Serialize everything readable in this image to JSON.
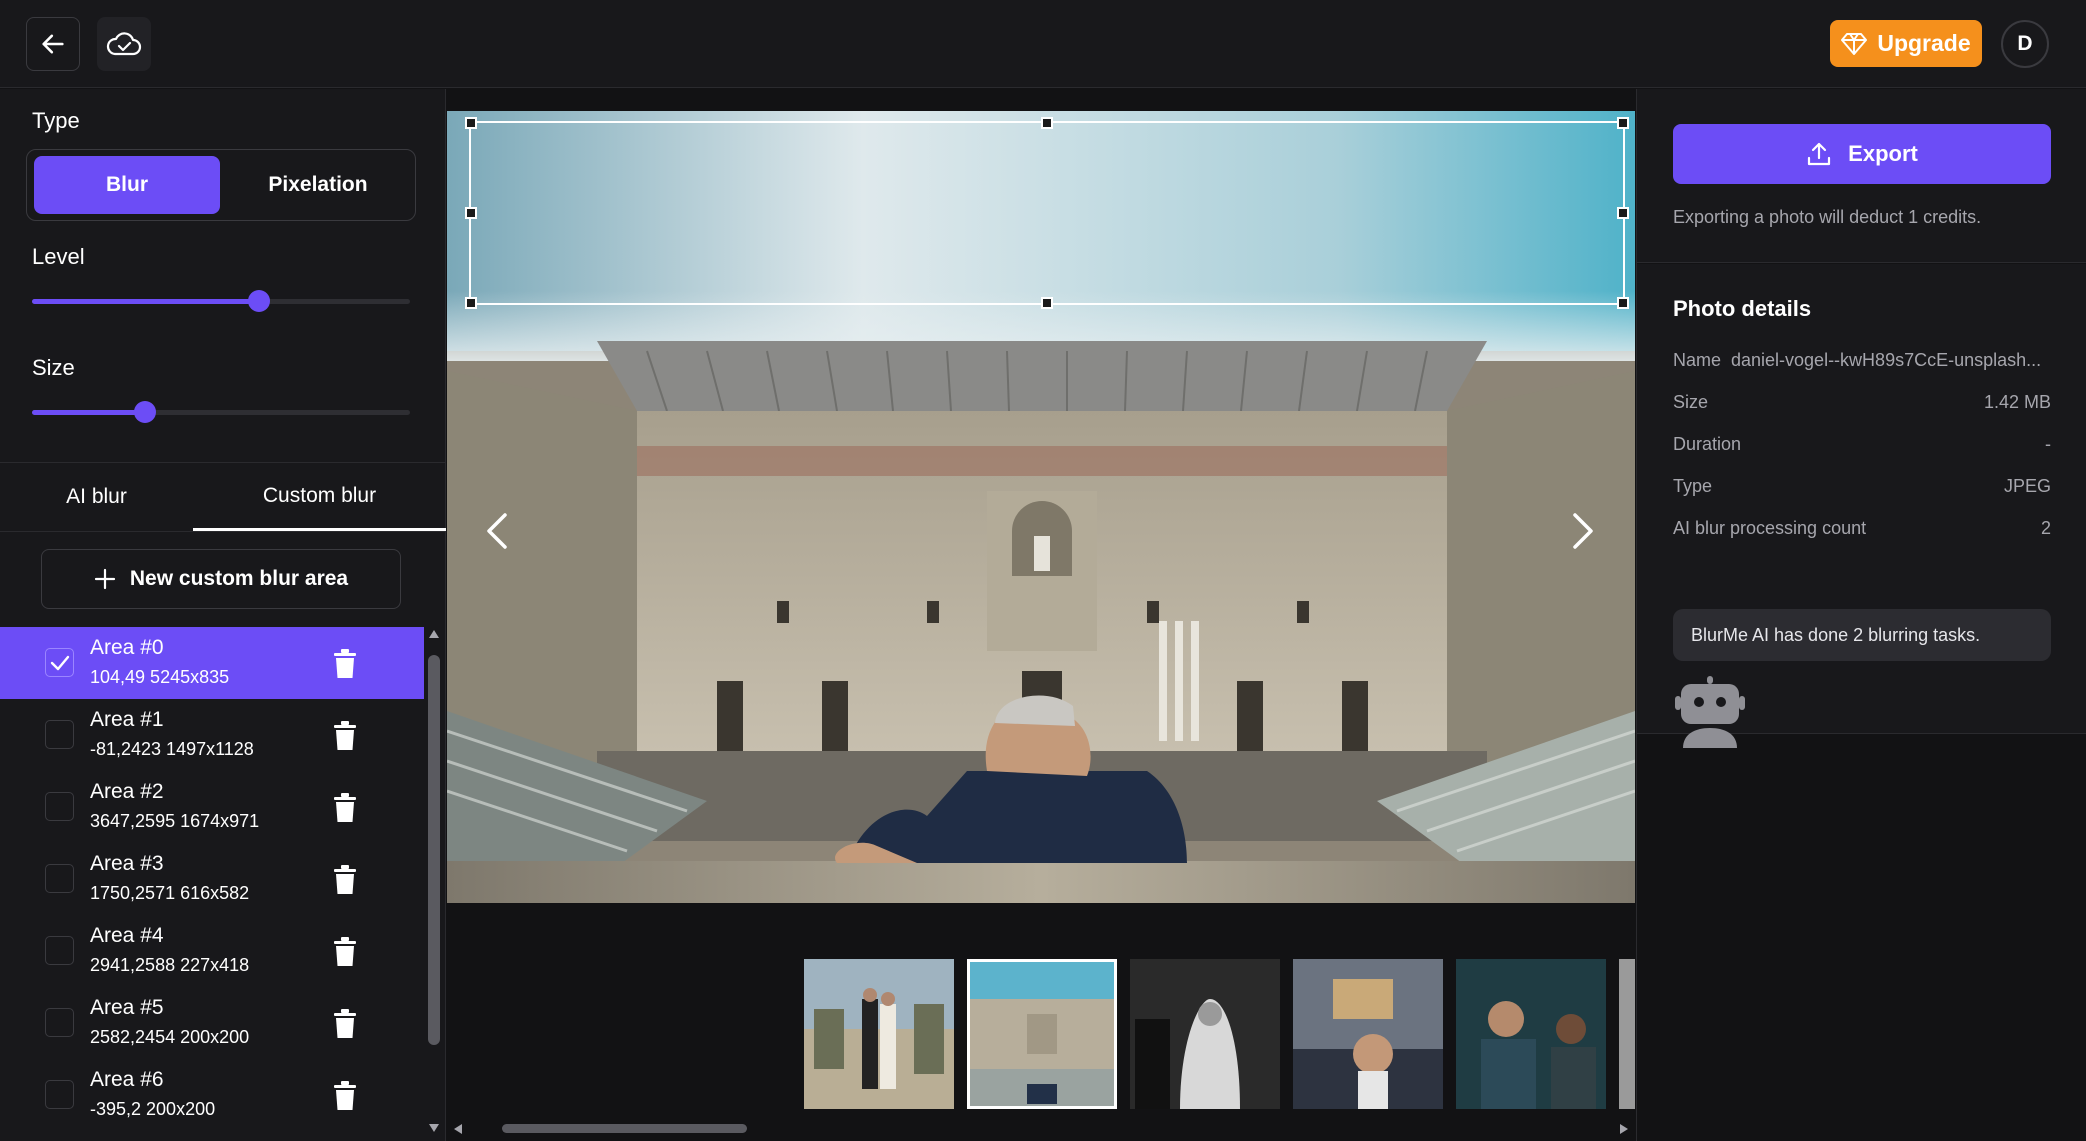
{
  "topbar": {
    "upgrade_label": "Upgrade",
    "avatar_initial": "D"
  },
  "left": {
    "type_label": "Type",
    "type_options": [
      "Blur",
      "Pixelation"
    ],
    "selected_type": "Blur",
    "level_label": "Level",
    "level_fraction": 0.6,
    "size_label": "Size",
    "size_fraction": 0.3,
    "tabs": [
      "AI blur",
      "Custom blur"
    ],
    "active_tab": "Custom blur",
    "new_area_label": "New custom blur area",
    "areas": [
      {
        "name": "Area #0",
        "coords": "104,49 5245x835",
        "checked": true
      },
      {
        "name": "Area #1",
        "coords": "-81,2423 1497x1128",
        "checked": false
      },
      {
        "name": "Area #2",
        "coords": "3647,2595 1674x971",
        "checked": false
      },
      {
        "name": "Area #3",
        "coords": "1750,2571 616x582",
        "checked": false
      },
      {
        "name": "Area #4",
        "coords": "2941,2588 227x418",
        "checked": false
      },
      {
        "name": "Area #5",
        "coords": "2582,2454 200x200",
        "checked": false
      },
      {
        "name": "Area #6",
        "coords": "-395,2 200x200",
        "checked": false
      }
    ]
  },
  "right": {
    "export_label": "Export",
    "export_note": "Exporting a photo will deduct 1 credits.",
    "details_title": "Photo details",
    "details": {
      "name_key": "Name",
      "name_val": "daniel-vogel--kwH89s7CcE-unsplash...",
      "size_key": "Size",
      "size_val": "1.42 MB",
      "duration_key": "Duration",
      "duration_val": "-",
      "type_key": "Type",
      "type_val": "JPEG",
      "count_key": "AI blur processing count",
      "count_val": "2"
    },
    "bubble": "BlurMe AI has done 2 blurring tasks."
  },
  "colors": {
    "accent": "#6c4df6",
    "upgrade": "#f5901c",
    "panel": "#18181b",
    "bg": "#121214"
  }
}
